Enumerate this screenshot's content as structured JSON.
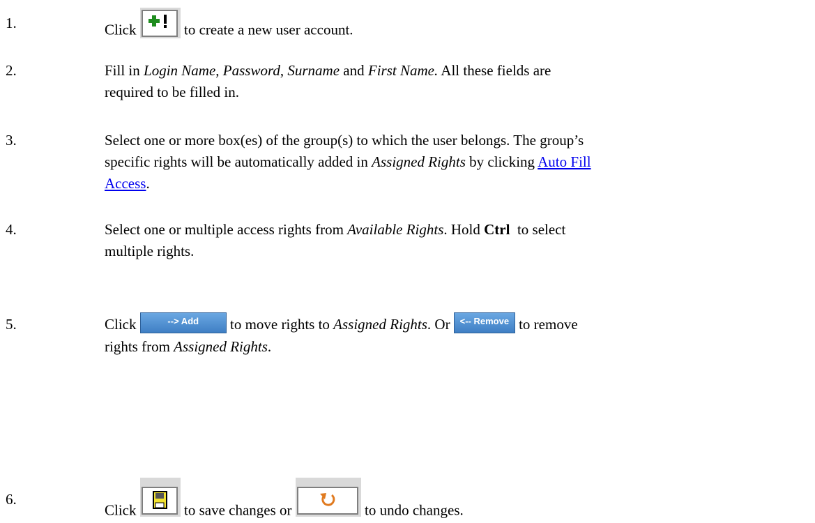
{
  "steps": [
    {
      "number": "1.",
      "before": "Click",
      "after": " to create a new user account.",
      "icon": "add-record-icon"
    },
    {
      "number": "2.",
      "t1": "Fill in ",
      "i1": "Login Name",
      "t2": ", ",
      "i2": "Password",
      "t3": ", ",
      "i3": "Surname",
      "t4": " and ",
      "i4": "First Name.",
      "t5": " All these fields are",
      "t6": "required to be filled in."
    },
    {
      "number": "3.",
      "t1": "Select one or more box(es) of the group(s) to which the user belongs. The group’s",
      "t2": "specific rights will be automatically added in ",
      "i1": "Assigned Rights",
      "t3": " by clicking ",
      "link_line1": "Auto Fill",
      "link_line2": "Access",
      "t4": "."
    },
    {
      "number": "4.",
      "t1": "Select one or multiple access rights from ",
      "i1": "Available Rights",
      "t2": ". Hold ",
      "b1": "Ctrl",
      "t3": "  to select",
      "t4": "multiple rights."
    },
    {
      "number": "5.",
      "t1": "Click ",
      "add_button": "--> Add",
      "t2": " to move rights to ",
      "i1": "Assigned Rights",
      "t3": ". Or ",
      "remove_button": "<-- Remove",
      "t4": " to remove",
      "t5": "rights from ",
      "i2": "Assigned Rights",
      "t6": "."
    },
    {
      "number": "6.",
      "t1": "Click ",
      "t2": " to save changes or ",
      "t3": " to undo changes.",
      "save_icon": "save-icon",
      "undo_icon": "undo-icon"
    }
  ],
  "colors": {
    "link": "#0000ee",
    "button_blue": "#4a8bd0",
    "toolbar_icon_bg": "#d9d9d9",
    "plus_green": "#1e8c1e",
    "save_yellow": "#f2e230",
    "undo_orange": "#e07a1f"
  }
}
